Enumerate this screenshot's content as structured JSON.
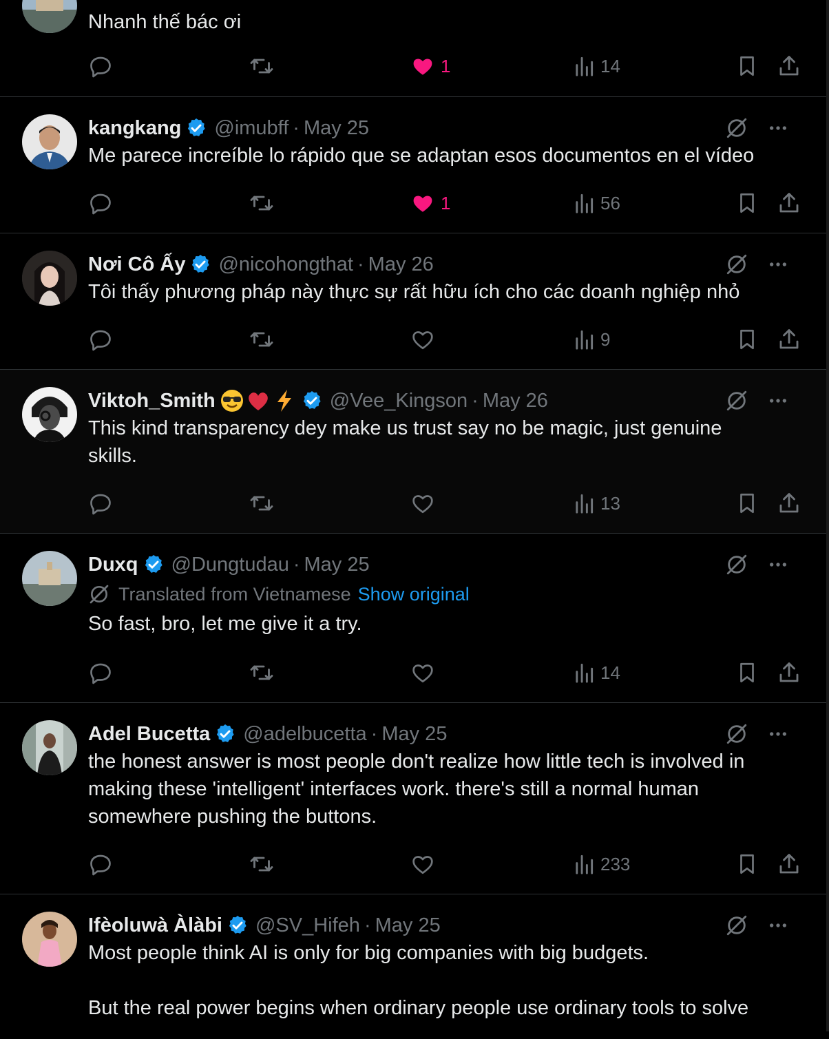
{
  "colors": {
    "background": "#000000",
    "text": "#e7e9ea",
    "muted": "#71767b",
    "accent": "#1d9bf0",
    "like": "#f91880",
    "divider": "#2f3336"
  },
  "tweets": [
    {
      "name": "",
      "handle": "",
      "date": "",
      "text": "Nhanh thế bác ơi",
      "replies": "",
      "reposts": "",
      "likes": "1",
      "liked": true,
      "views": "14"
    },
    {
      "name": "kangkang",
      "handle": "@imubff",
      "date": "May 25",
      "text": "Me parece increíble lo rápido que se adaptan esos documentos en el vídeo",
      "likes": "1",
      "liked": true,
      "views": "56"
    },
    {
      "name": "Nơi Cô Ấy",
      "handle": "@nicohongthat",
      "date": "May 26",
      "text": "Tôi thấy phương pháp này thực sự rất hữu ích cho các doanh nghiệp nhỏ",
      "likes": "",
      "liked": false,
      "views": "9"
    },
    {
      "name": "Viktoh_Smith",
      "emoji": [
        "sunglasses-emoji",
        "red-heart-emoji",
        "lightning-emoji"
      ],
      "handle": "@Vee_Kingson",
      "date": "May 26",
      "text": "This kind transparency dey make us trust say no be magic, just genuine\nskills.",
      "likes": "",
      "liked": false,
      "views": "13"
    },
    {
      "name": "Duxq",
      "handle": "@Dungtudau",
      "date": "May 25",
      "translated_label": "Translated from Vietnamese",
      "show_original": "Show original",
      "text": "So fast, bro, let me give it a try.",
      "likes": "",
      "liked": false,
      "views": "14"
    },
    {
      "name": "Adel Bucetta",
      "handle": "@adelbucetta",
      "date": "May 25",
      "text": "the honest answer is most people don't realize how little tech is involved in\nmaking these 'intelligent' interfaces work. there's still a normal human\nsomewhere pushing the buttons.",
      "likes": "",
      "liked": false,
      "views": "233"
    },
    {
      "name": "Ifèoluwà Àlàbi",
      "handle": "@SV_Hifeh",
      "date": "May 25",
      "text": "Most people think AI is only for big companies with big budgets.\n\nBut the real power begins when ordinary people use ordinary tools to solve"
    }
  ],
  "icons": {
    "reply": "reply-icon",
    "repost": "repost-icon",
    "like": "heart-icon",
    "views": "views-icon",
    "bookmark": "bookmark-icon",
    "share": "share-icon",
    "grok": "grok-icon",
    "more": "more-icon",
    "verified": "verified-badge-icon"
  }
}
